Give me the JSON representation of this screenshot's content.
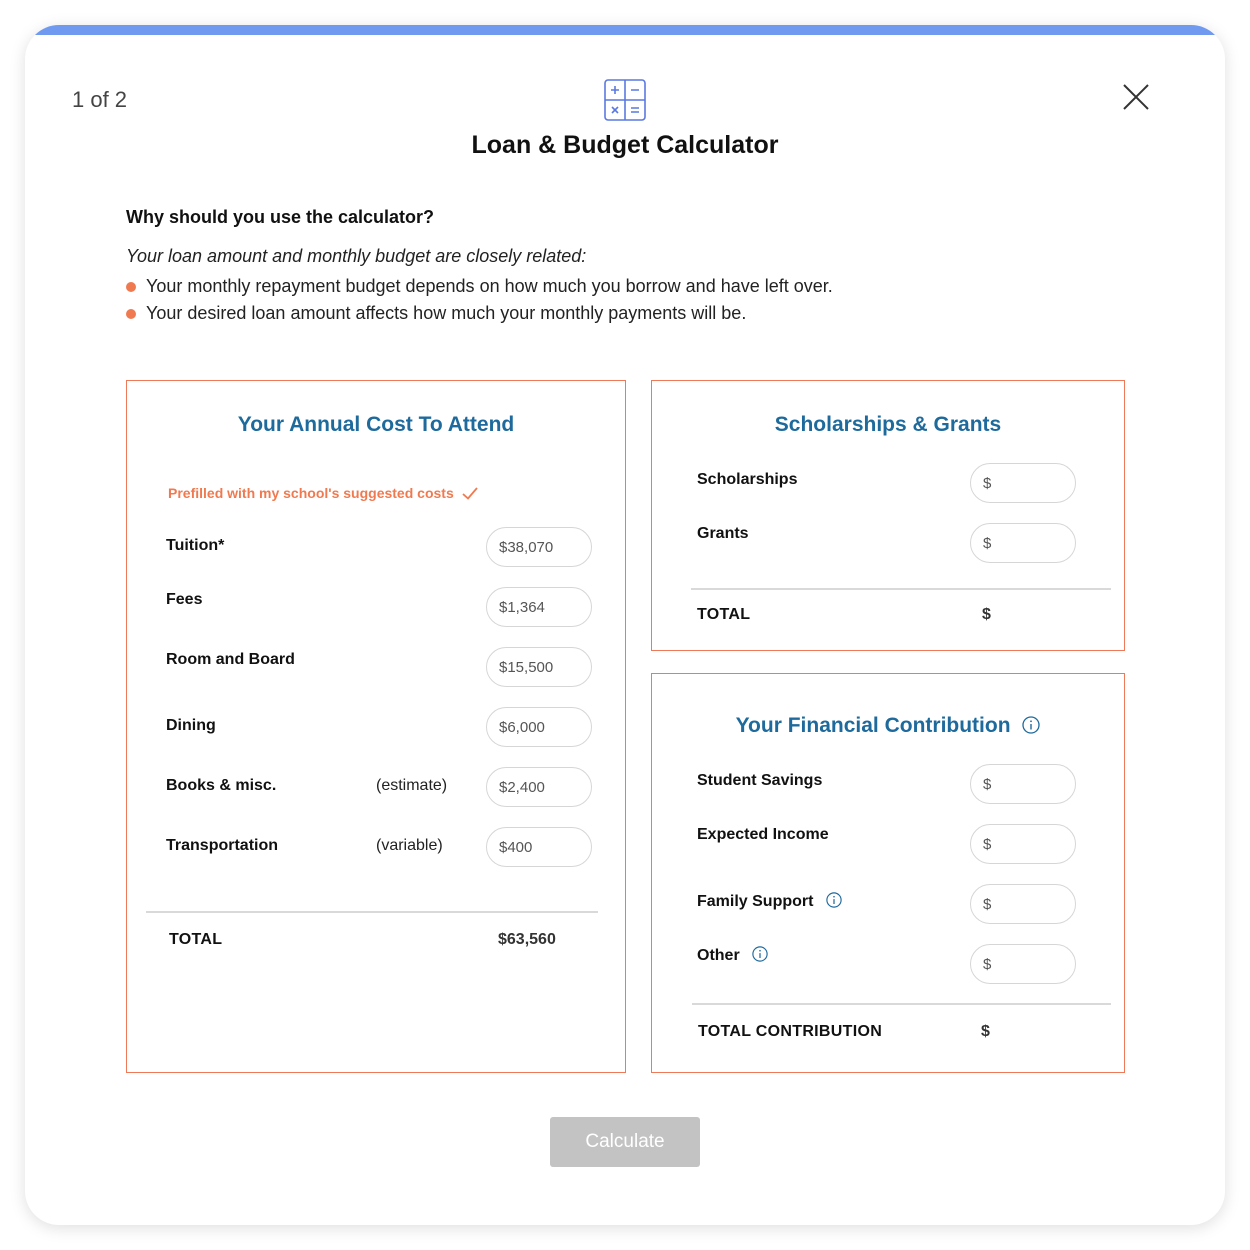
{
  "header": {
    "step": "1 of 2",
    "title": "Loan & Budget Calculator",
    "icons": {
      "close": "close-icon",
      "calculator": "calculator-icon"
    }
  },
  "intro": {
    "question": "Why should you use the calculator?",
    "lead": "Your loan amount and monthly budget are closely related:",
    "bullets": [
      "Your monthly repayment budget depends on how much you borrow and have left over.",
      "Your desired loan amount affects how much your monthly payments will be."
    ]
  },
  "cost": {
    "title": "Your Annual Cost To Attend",
    "prefill_note": "Prefilled with my school's suggested costs",
    "rows": [
      {
        "label": "Tuition*",
        "note": "",
        "value": "$38,070"
      },
      {
        "label": "Fees",
        "note": "",
        "value": "$1,364"
      },
      {
        "label": "Room and Board",
        "note": "",
        "value": "$15,500"
      },
      {
        "label": "Dining",
        "note": "",
        "value": "$6,000"
      },
      {
        "label": "Books & misc.",
        "note": "(estimate)",
        "value": "$2,400"
      },
      {
        "label": "Transportation",
        "note": "(variable)",
        "value": "$400"
      }
    ],
    "total_label": "TOTAL",
    "total_value": "$63,560"
  },
  "scholarships": {
    "title": "Scholarships & Grants",
    "rows": [
      {
        "label": "Scholarships",
        "placeholder": "$"
      },
      {
        "label": "Grants",
        "placeholder": "$"
      }
    ],
    "total_label": "TOTAL",
    "total_value": "$"
  },
  "contribution": {
    "title": "Your Financial Contribution",
    "rows": [
      {
        "label": "Student Savings",
        "placeholder": "$"
      },
      {
        "label": "Expected Income",
        "placeholder": "$"
      },
      {
        "label": "Family Support",
        "placeholder": "$"
      },
      {
        "label": "Other",
        "placeholder": "$"
      }
    ],
    "total_label": "TOTAL CONTRIBUTION",
    "total_value": "$"
  },
  "actions": {
    "calculate": "Calculate"
  },
  "colors": {
    "accent_bar": "#6f9af0",
    "panel_border": "#ee7a59",
    "heading_blue": "#1e6a9c",
    "bullet_orange": "#f07a50",
    "button_disabled": "#c3c3c3"
  }
}
